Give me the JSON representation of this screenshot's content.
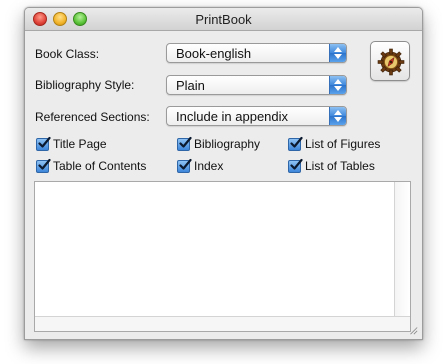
{
  "window": {
    "title": "PrintBook"
  },
  "form": {
    "book_class_label": "Book Class:",
    "book_class_value": "Book-english",
    "bibliography_style_label": "Bibliography Style:",
    "bibliography_style_value": "Plain",
    "referenced_sections_label": "Referenced Sections:",
    "referenced_sections_value": "Include in appendix"
  },
  "options": [
    {
      "label": "Title Page",
      "checked": true
    },
    {
      "label": "Bibliography",
      "checked": true
    },
    {
      "label": "List of Figures",
      "checked": true
    },
    {
      "label": "Table of Contents",
      "checked": true
    },
    {
      "label": "Index",
      "checked": true
    },
    {
      "label": "List of Tables",
      "checked": true
    }
  ],
  "log_text": "",
  "colors": {
    "accent": "#3d86da",
    "window_bg": "#ececec"
  },
  "icons": {
    "action": "gear-compass-icon"
  }
}
